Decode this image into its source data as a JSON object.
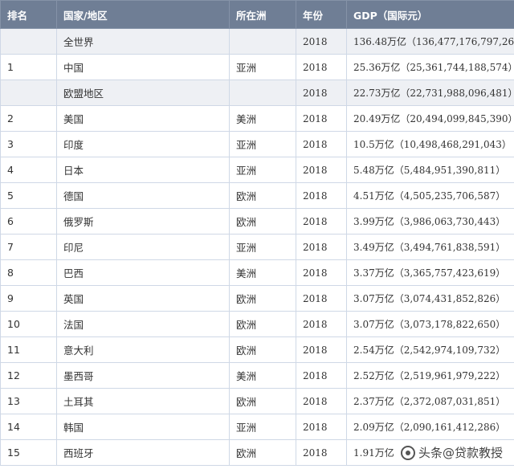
{
  "table": {
    "headers": [
      "排名",
      "国家/地区",
      "所在洲",
      "年份",
      "GDP（国际元）"
    ],
    "rows": [
      {
        "rank": "",
        "country": "全世界",
        "continent": "",
        "year": "2018",
        "gdp": "136.48万亿（136,477,176,797,269）",
        "shaded": true
      },
      {
        "rank": "1",
        "country": "中国",
        "continent": "亚洲",
        "year": "2018",
        "gdp": "25.36万亿（25,361,744,188,574）",
        "shaded": false
      },
      {
        "rank": "",
        "country": "欧盟地区",
        "continent": "",
        "year": "2018",
        "gdp": "22.73万亿（22,731,988,096,481）",
        "shaded": true
      },
      {
        "rank": "2",
        "country": "美国",
        "continent": "美洲",
        "year": "2018",
        "gdp": "20.49万亿（20,494,099,845,390）",
        "shaded": false
      },
      {
        "rank": "3",
        "country": "印度",
        "continent": "亚洲",
        "year": "2018",
        "gdp": "10.5万亿（10,498,468,291,043）",
        "shaded": false
      },
      {
        "rank": "4",
        "country": "日本",
        "continent": "亚洲",
        "year": "2018",
        "gdp": "5.48万亿（5,484,951,390,811）",
        "shaded": false
      },
      {
        "rank": "5",
        "country": "德国",
        "continent": "欧洲",
        "year": "2018",
        "gdp": "4.51万亿（4,505,235,706,587）",
        "shaded": false
      },
      {
        "rank": "6",
        "country": "俄罗斯",
        "continent": "欧洲",
        "year": "2018",
        "gdp": "3.99万亿（3,986,063,730,443）",
        "shaded": false
      },
      {
        "rank": "7",
        "country": "印尼",
        "continent": "亚洲",
        "year": "2018",
        "gdp": "3.49万亿（3,494,761,838,591）",
        "shaded": false
      },
      {
        "rank": "8",
        "country": "巴西",
        "continent": "美洲",
        "year": "2018",
        "gdp": "3.37万亿（3,365,757,423,619）",
        "shaded": false
      },
      {
        "rank": "9",
        "country": "英国",
        "continent": "欧洲",
        "year": "2018",
        "gdp": "3.07万亿（3,074,431,852,826）",
        "shaded": false
      },
      {
        "rank": "10",
        "country": "法国",
        "continent": "欧洲",
        "year": "2018",
        "gdp": "3.07万亿（3,073,178,822,650）",
        "shaded": false
      },
      {
        "rank": "11",
        "country": "意大利",
        "continent": "欧洲",
        "year": "2018",
        "gdp": "2.54万亿（2,542,974,109,732）",
        "shaded": false
      },
      {
        "rank": "12",
        "country": "墨西哥",
        "continent": "美洲",
        "year": "2018",
        "gdp": "2.52万亿（2,519,961,979,222）",
        "shaded": false
      },
      {
        "rank": "13",
        "country": "土耳其",
        "continent": "欧洲",
        "year": "2018",
        "gdp": "2.37万亿（2,372,087,031,851）",
        "shaded": false
      },
      {
        "rank": "14",
        "country": "韩国",
        "continent": "亚洲",
        "year": "2018",
        "gdp": "2.09万亿（2,090,161,412,286）",
        "shaded": false
      },
      {
        "rank": "15",
        "country": "西班牙",
        "continent": "欧洲",
        "year": "2018",
        "gdp": "1.91万亿（",
        "shaded": false
      }
    ]
  },
  "watermark": {
    "text": "头条@贷款教授",
    "icon": "toutiao-logo-icon"
  },
  "colors": {
    "header_bg": "#6f7e95",
    "shaded_row_bg": "#eef0f4",
    "border": "#cfd8e6"
  }
}
